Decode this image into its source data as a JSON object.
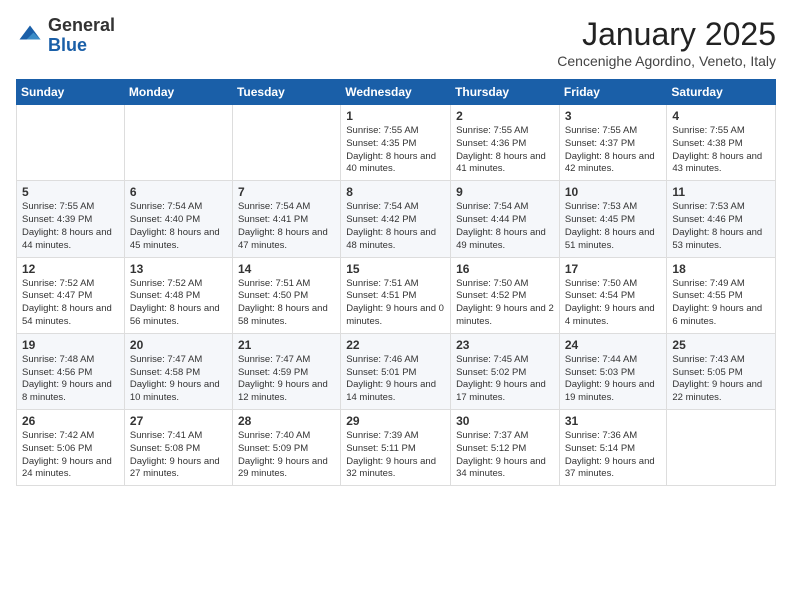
{
  "logo": {
    "general": "General",
    "blue": "Blue"
  },
  "header": {
    "title": "January 2025",
    "location": "Cencenighe Agordino, Veneto, Italy"
  },
  "days_of_week": [
    "Sunday",
    "Monday",
    "Tuesday",
    "Wednesday",
    "Thursday",
    "Friday",
    "Saturday"
  ],
  "weeks": [
    [
      {
        "day": "",
        "content": ""
      },
      {
        "day": "",
        "content": ""
      },
      {
        "day": "",
        "content": ""
      },
      {
        "day": "1",
        "content": "Sunrise: 7:55 AM\nSunset: 4:35 PM\nDaylight: 8 hours and 40 minutes."
      },
      {
        "day": "2",
        "content": "Sunrise: 7:55 AM\nSunset: 4:36 PM\nDaylight: 8 hours and 41 minutes."
      },
      {
        "day": "3",
        "content": "Sunrise: 7:55 AM\nSunset: 4:37 PM\nDaylight: 8 hours and 42 minutes."
      },
      {
        "day": "4",
        "content": "Sunrise: 7:55 AM\nSunset: 4:38 PM\nDaylight: 8 hours and 43 minutes."
      }
    ],
    [
      {
        "day": "5",
        "content": "Sunrise: 7:55 AM\nSunset: 4:39 PM\nDaylight: 8 hours and 44 minutes."
      },
      {
        "day": "6",
        "content": "Sunrise: 7:54 AM\nSunset: 4:40 PM\nDaylight: 8 hours and 45 minutes."
      },
      {
        "day": "7",
        "content": "Sunrise: 7:54 AM\nSunset: 4:41 PM\nDaylight: 8 hours and 47 minutes."
      },
      {
        "day": "8",
        "content": "Sunrise: 7:54 AM\nSunset: 4:42 PM\nDaylight: 8 hours and 48 minutes."
      },
      {
        "day": "9",
        "content": "Sunrise: 7:54 AM\nSunset: 4:44 PM\nDaylight: 8 hours and 49 minutes."
      },
      {
        "day": "10",
        "content": "Sunrise: 7:53 AM\nSunset: 4:45 PM\nDaylight: 8 hours and 51 minutes."
      },
      {
        "day": "11",
        "content": "Sunrise: 7:53 AM\nSunset: 4:46 PM\nDaylight: 8 hours and 53 minutes."
      }
    ],
    [
      {
        "day": "12",
        "content": "Sunrise: 7:52 AM\nSunset: 4:47 PM\nDaylight: 8 hours and 54 minutes."
      },
      {
        "day": "13",
        "content": "Sunrise: 7:52 AM\nSunset: 4:48 PM\nDaylight: 8 hours and 56 minutes."
      },
      {
        "day": "14",
        "content": "Sunrise: 7:51 AM\nSunset: 4:50 PM\nDaylight: 8 hours and 58 minutes."
      },
      {
        "day": "15",
        "content": "Sunrise: 7:51 AM\nSunset: 4:51 PM\nDaylight: 9 hours and 0 minutes."
      },
      {
        "day": "16",
        "content": "Sunrise: 7:50 AM\nSunset: 4:52 PM\nDaylight: 9 hours and 2 minutes."
      },
      {
        "day": "17",
        "content": "Sunrise: 7:50 AM\nSunset: 4:54 PM\nDaylight: 9 hours and 4 minutes."
      },
      {
        "day": "18",
        "content": "Sunrise: 7:49 AM\nSunset: 4:55 PM\nDaylight: 9 hours and 6 minutes."
      }
    ],
    [
      {
        "day": "19",
        "content": "Sunrise: 7:48 AM\nSunset: 4:56 PM\nDaylight: 9 hours and 8 minutes."
      },
      {
        "day": "20",
        "content": "Sunrise: 7:47 AM\nSunset: 4:58 PM\nDaylight: 9 hours and 10 minutes."
      },
      {
        "day": "21",
        "content": "Sunrise: 7:47 AM\nSunset: 4:59 PM\nDaylight: 9 hours and 12 minutes."
      },
      {
        "day": "22",
        "content": "Sunrise: 7:46 AM\nSunset: 5:01 PM\nDaylight: 9 hours and 14 minutes."
      },
      {
        "day": "23",
        "content": "Sunrise: 7:45 AM\nSunset: 5:02 PM\nDaylight: 9 hours and 17 minutes."
      },
      {
        "day": "24",
        "content": "Sunrise: 7:44 AM\nSunset: 5:03 PM\nDaylight: 9 hours and 19 minutes."
      },
      {
        "day": "25",
        "content": "Sunrise: 7:43 AM\nSunset: 5:05 PM\nDaylight: 9 hours and 22 minutes."
      }
    ],
    [
      {
        "day": "26",
        "content": "Sunrise: 7:42 AM\nSunset: 5:06 PM\nDaylight: 9 hours and 24 minutes."
      },
      {
        "day": "27",
        "content": "Sunrise: 7:41 AM\nSunset: 5:08 PM\nDaylight: 9 hours and 27 minutes."
      },
      {
        "day": "28",
        "content": "Sunrise: 7:40 AM\nSunset: 5:09 PM\nDaylight: 9 hours and 29 minutes."
      },
      {
        "day": "29",
        "content": "Sunrise: 7:39 AM\nSunset: 5:11 PM\nDaylight: 9 hours and 32 minutes."
      },
      {
        "day": "30",
        "content": "Sunrise: 7:37 AM\nSunset: 5:12 PM\nDaylight: 9 hours and 34 minutes."
      },
      {
        "day": "31",
        "content": "Sunrise: 7:36 AM\nSunset: 5:14 PM\nDaylight: 9 hours and 37 minutes."
      },
      {
        "day": "",
        "content": ""
      }
    ]
  ]
}
